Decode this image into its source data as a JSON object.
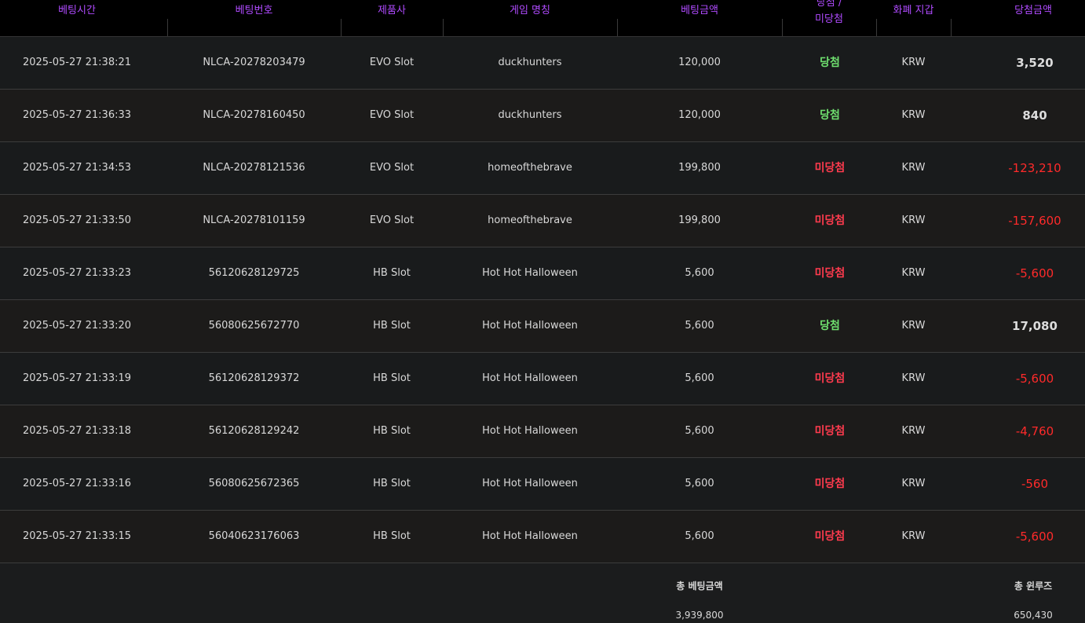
{
  "columns": {
    "bet_time": "베팅시간",
    "bet_no": "베팅번호",
    "provider": "제품사",
    "game_name": "게임 명칭",
    "bet_amount": "베팅금액",
    "result_line1": "당첨 /",
    "result_line2": "미당첨",
    "currency": "화폐 지갑",
    "win_amount": "당첨금액"
  },
  "rows": [
    {
      "time": "2025-05-27 21:38:21",
      "no": "NLCA-20278203479",
      "provider": "EVO Slot",
      "game": "duckhunters",
      "bet": "120,000",
      "result": "당첨",
      "result_type": "win",
      "currency": "KRW",
      "amount": "3,520",
      "amount_type": "pos"
    },
    {
      "time": "2025-05-27 21:36:33",
      "no": "NLCA-20278160450",
      "provider": "EVO Slot",
      "game": "duckhunters",
      "bet": "120,000",
      "result": "당첨",
      "result_type": "win",
      "currency": "KRW",
      "amount": "840",
      "amount_type": "pos"
    },
    {
      "time": "2025-05-27 21:34:53",
      "no": "NLCA-20278121536",
      "provider": "EVO Slot",
      "game": "homeofthebrave",
      "bet": "199,800",
      "result": "미당첨",
      "result_type": "lose",
      "currency": "KRW",
      "amount": "-123,210",
      "amount_type": "neg"
    },
    {
      "time": "2025-05-27 21:33:50",
      "no": "NLCA-20278101159",
      "provider": "EVO Slot",
      "game": "homeofthebrave",
      "bet": "199,800",
      "result": "미당첨",
      "result_type": "lose",
      "currency": "KRW",
      "amount": "-157,600",
      "amount_type": "neg"
    },
    {
      "time": "2025-05-27 21:33:23",
      "no": "56120628129725",
      "provider": "HB Slot",
      "game": "Hot Hot Halloween",
      "bet": "5,600",
      "result": "미당첨",
      "result_type": "lose",
      "currency": "KRW",
      "amount": "-5,600",
      "amount_type": "neg"
    },
    {
      "time": "2025-05-27 21:33:20",
      "no": "56080625672770",
      "provider": "HB Slot",
      "game": "Hot Hot Halloween",
      "bet": "5,600",
      "result": "당첨",
      "result_type": "win",
      "currency": "KRW",
      "amount": "17,080",
      "amount_type": "pos"
    },
    {
      "time": "2025-05-27 21:33:19",
      "no": "56120628129372",
      "provider": "HB Slot",
      "game": "Hot Hot Halloween",
      "bet": "5,600",
      "result": "미당첨",
      "result_type": "lose",
      "currency": "KRW",
      "amount": "-5,600",
      "amount_type": "neg"
    },
    {
      "time": "2025-05-27 21:33:18",
      "no": "56120628129242",
      "provider": "HB Slot",
      "game": "Hot Hot Halloween",
      "bet": "5,600",
      "result": "미당첨",
      "result_type": "lose",
      "currency": "KRW",
      "amount": "-4,760",
      "amount_type": "neg"
    },
    {
      "time": "2025-05-27 21:33:16",
      "no": "56080625672365",
      "provider": "HB Slot",
      "game": "Hot Hot Halloween",
      "bet": "5,600",
      "result": "미당첨",
      "result_type": "lose",
      "currency": "KRW",
      "amount": "-560",
      "amount_type": "neg"
    },
    {
      "time": "2025-05-27 21:33:15",
      "no": "56040623176063",
      "provider": "HB Slot",
      "game": "Hot Hot Halloween",
      "bet": "5,600",
      "result": "미당첨",
      "result_type": "lose",
      "currency": "KRW",
      "amount": "-5,600",
      "amount_type": "neg"
    }
  ],
  "footer": {
    "total_bet_label": "총 베팅금액",
    "total_bet_value": "3,939,800",
    "total_win_label": "총 윈루즈",
    "total_win_value": "650,430"
  },
  "colors": {
    "header_text": "#b04bff",
    "win": "#6fe06f",
    "lose": "#ff3b4e",
    "negative_amount": "#ff2a2a"
  }
}
